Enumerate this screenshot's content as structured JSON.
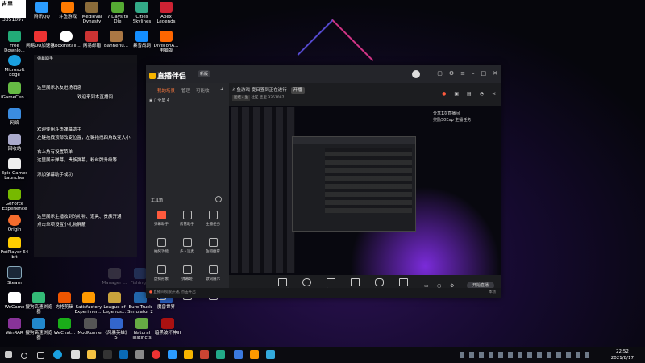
{
  "stream_overlay": {
    "title": "吉里",
    "viewers": "3351097"
  },
  "desktop_icons": {
    "d0": "Free Downlo...",
    "d1": "Microsoft Edge",
    "d2": "iGameCen...",
    "d3": "网络",
    "d4": "回收站",
    "d5": "Epic Games Launcher",
    "d6": "GeForce Experience",
    "d7": "Origin",
    "d8": "PotPlayer 64 bit",
    "d9": "Steam",
    "d10": "WeGame",
    "d11": "WinRAR",
    "top1": "腾讯QQ",
    "top2": "斗鱼游戏",
    "top3": "Medieval Dynasty",
    "top4": "7 Days to Die",
    "top5": "Cities Skylines",
    "top6": "Apex Legends",
    "r1_1": "网易UU加速器",
    "r1_2": "XboxInstall...",
    "r1_3": "网易邮箱",
    "r1_4": "Banneriu...",
    "r1_5": "暴雪战网",
    "r1_6": "DivisionA... 电脑版",
    "bot1": "搜狗高速浏览器",
    "bot2": "方格剪辑",
    "bot3": "Satisfactory Experimen...",
    "bot4": "League of Legends...",
    "bot5": "Euro Truck Simulator 2",
    "bot6": "魔兽世界",
    "bot7": "搜狗高速浏览器",
    "bot8": "WeChat...",
    "bot9": "ModRunner",
    "bot10": "《风暴英雄》 5",
    "bot11": "Natural Instincts",
    "bot12": "暗黑破坏神III",
    "mgr": "Manager ...",
    "fish": "Fishing..."
  },
  "overlay_panel": {
    "header": "弹幕助手",
    "line1": "这里展示水友进场消息",
    "line2": "欢迎来到本直播间",
    "line3": "欢迎使用斗鱼弹幕助手",
    "line4": "左键拖拽顶部改变位置，左键拖拽四角改变大小",
    "line5": "右上角有设置菜单",
    "line6": "这里展示弹幕，贵族弹幕，粉丝牌升级等",
    "line7": "添加弹幕助手成功",
    "line8": "这里展示主播收到的礼物、道具、贵族开通",
    "line9": "点击单项设置小礼物屏蔽"
  },
  "app": {
    "name": "直播伴侣",
    "version_tag": "新版",
    "side_tabs": [
      "我的场景",
      "管理",
      "可能收"
    ],
    "scene": "全屏 4",
    "tools_label": "工具箱",
    "grid": [
      "弹幕助手",
      "房管助手",
      "主播任务",
      "抽奖功能",
      "多人连麦",
      "鱼吧推荐",
      "虚拟形象",
      "弹幕姬",
      "歌词展示",
      "",
      "",
      ""
    ],
    "room_title": "斗鱼游戏 夏日签到正在进行",
    "room_tag": "开播",
    "room_meta": [
      "团结人生",
      "社区",
      "吉里",
      "3351097"
    ],
    "preview_side_text": [
      "分享1次直播间",
      "奖励50Exp 主播任务"
    ],
    "toolbar": [
      "直播屏幕",
      "摄像头",
      "手机投屏",
      "多媒体",
      "麦克风",
      "扬声器"
    ],
    "start_button": "开始直播",
    "status": "直播间权限开通, 点击开启",
    "status_right": "本场"
  },
  "taskbar": {
    "time": "22:52",
    "date": "2021/8/17"
  },
  "colors": {
    "accent": "#ff7a3d",
    "brand": "#f7b500",
    "window_bg": "#1f2023"
  }
}
